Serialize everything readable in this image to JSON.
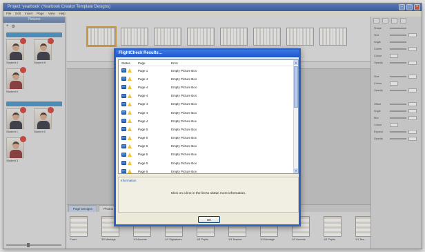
{
  "window": {
    "title": "Project 'yearbook' (Yearbook Creator Template Designs)",
    "menu": [
      "File",
      "Edit",
      "Insert",
      "Page",
      "View",
      "Help"
    ]
  },
  "pictures_panel": {
    "header": "Pictures",
    "students": [
      "Student 4",
      "Student 5",
      "Student 6",
      "Student 1",
      "Student 2",
      "Student 3"
    ]
  },
  "bottom_panel": {
    "tabs": [
      "Page Designs",
      "Photos"
    ],
    "templates": [
      "Cover",
      "3D Montage",
      "1/3 Accents",
      "1/3 Signatures",
      "1/3 Pupils",
      "1/3 Teacher",
      "1/3 Montage",
      "1/3 Accents",
      "1/2 Pupils",
      "1/1 Tea..."
    ]
  },
  "right_panel": {
    "rows": [
      "Shape",
      "Size",
      "Angle",
      "Corner",
      "Colour",
      "Opacity",
      "Size",
      "Colour",
      "Opacity",
      "Offset",
      "Angle",
      "Blur",
      "Colour",
      "Expand",
      "Opacity"
    ]
  },
  "dialog": {
    "title": "FlightCheck Results...",
    "columns": {
      "status": "Status",
      "page": "Page",
      "error": "Error"
    },
    "rows": [
      {
        "page": "Page 1",
        "error": "Empty Picture Box"
      },
      {
        "page": "Page 4",
        "error": "Empty Picture Box"
      },
      {
        "page": "Page 4",
        "error": "Empty Picture Box"
      },
      {
        "page": "Page 4",
        "error": "Empty Picture Box"
      },
      {
        "page": "Page 4",
        "error": "Empty Picture Box"
      },
      {
        "page": "Page 4",
        "error": "Empty Picture Box"
      },
      {
        "page": "Page 4",
        "error": "Empty Picture Box"
      },
      {
        "page": "Page 5",
        "error": "Empty Picture Box"
      },
      {
        "page": "Page 5",
        "error": "Empty Picture Box"
      },
      {
        "page": "Page 5",
        "error": "Empty Picture Box"
      },
      {
        "page": "Page 5",
        "error": "Empty Picture Box"
      },
      {
        "page": "Page 5",
        "error": "Empty Picture Box"
      },
      {
        "page": "Page 5",
        "error": "Empty Picture Box"
      }
    ],
    "information_label": "Information",
    "information_text": "Click on a line in the list to obtain more information.",
    "ok_label": "OK"
  },
  "colors": {
    "title_bar": "#1f4ea8",
    "accent_blue": "#3a8fc8",
    "warning": "#f2c230",
    "badge": "#d8352a"
  }
}
